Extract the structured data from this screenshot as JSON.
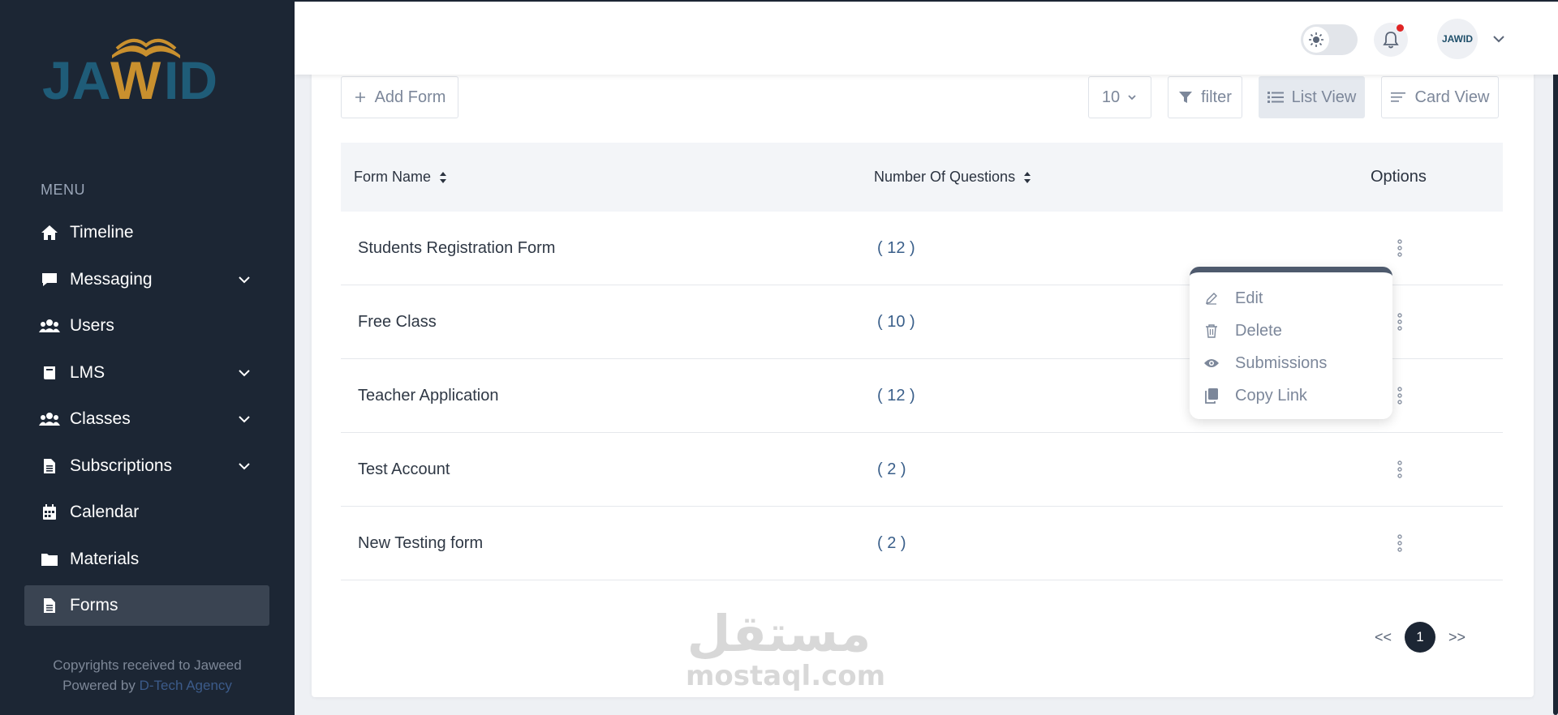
{
  "sidebar": {
    "logo_text": "JAWID",
    "menu_title": "MENU",
    "items": [
      {
        "label": "Timeline",
        "icon": "home-icon",
        "has_chevron": false
      },
      {
        "label": "Messaging",
        "icon": "chat-icon",
        "has_chevron": true
      },
      {
        "label": "Users",
        "icon": "users-icon",
        "has_chevron": false
      },
      {
        "label": "LMS",
        "icon": "book-icon",
        "has_chevron": true
      },
      {
        "label": "Classes",
        "icon": "users-icon",
        "has_chevron": true
      },
      {
        "label": "Subscriptions",
        "icon": "document-icon",
        "has_chevron": true
      },
      {
        "label": "Calendar",
        "icon": "calendar-icon",
        "has_chevron": false
      },
      {
        "label": "Materials",
        "icon": "folder-icon",
        "has_chevron": false
      },
      {
        "label": "Forms",
        "icon": "document-icon",
        "has_chevron": false,
        "active": true
      }
    ],
    "footer_line1": "Copyrights received to Jaweed",
    "footer_powered": "Powered by",
    "footer_link": "D-Tech Agency"
  },
  "topbar": {
    "avatar_text": "JAWID"
  },
  "toolbar": {
    "add_label": "Add Form",
    "per_page": "10",
    "filter_label": "filter",
    "list_view_label": "List View",
    "card_view_label": "Card View"
  },
  "table": {
    "columns": [
      "Form Name",
      "Number Of Questions",
      "Options"
    ],
    "rows": [
      {
        "name": "Students Registration Form",
        "count": "( 12 )"
      },
      {
        "name": "Free Class",
        "count": "( 10 )"
      },
      {
        "name": "Teacher Application",
        "count": "( 12 )"
      },
      {
        "name": "Test Account",
        "count": "( 2 )"
      },
      {
        "name": "New Testing form",
        "count": "( 2 )"
      }
    ]
  },
  "options_menu": {
    "items": [
      {
        "label": "Edit",
        "icon": "pencil-icon"
      },
      {
        "label": "Delete",
        "icon": "trash-icon"
      },
      {
        "label": "Submissions",
        "icon": "eye-icon"
      },
      {
        "label": "Copy Link",
        "icon": "copy-icon"
      }
    ]
  },
  "pagination": {
    "prev": "<<",
    "current": "1",
    "next": ">>"
  },
  "watermark": {
    "arabic": "مستقل",
    "latin": "mostaql.com"
  },
  "colors": {
    "sidebar_bg": "#1c2634",
    "accent_text": "#3a5f8a",
    "notification_dot": "#e02424"
  }
}
